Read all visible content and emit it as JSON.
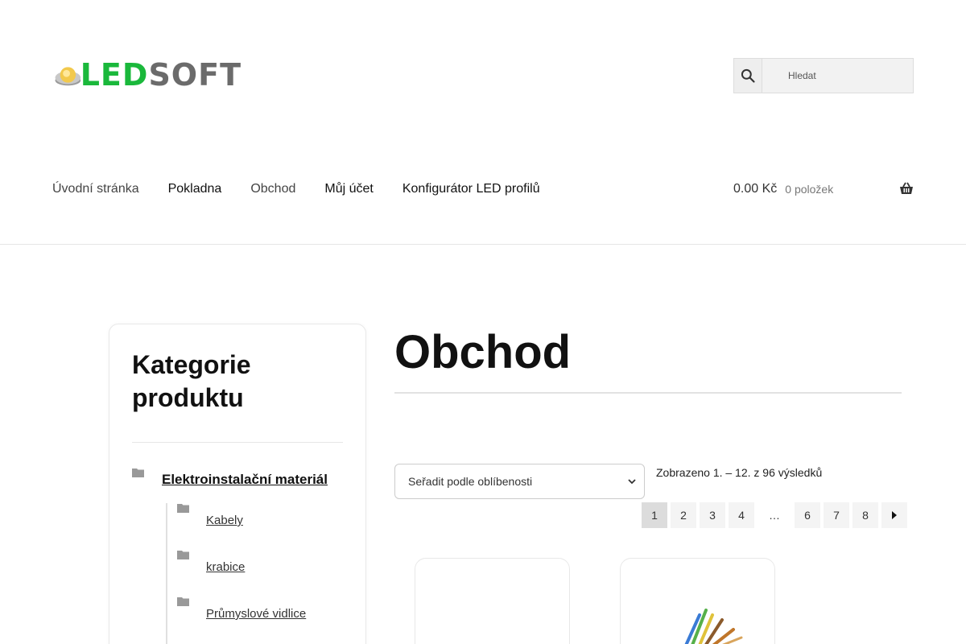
{
  "header": {
    "logo": {
      "part1": "LED",
      "part2": "SOFT"
    },
    "search": {
      "placeholder": "Hledat"
    }
  },
  "nav": {
    "items": [
      {
        "label": "Úvodní stránka"
      },
      {
        "label": "Pokladna"
      },
      {
        "label": "Obchod"
      },
      {
        "label": "Můj účet"
      },
      {
        "label": "Konfigurátor LED profilů"
      }
    ]
  },
  "cart": {
    "amount": "0.00 Kč",
    "count": "0 položek"
  },
  "sidebar": {
    "title": "Kategorie produktu",
    "main_category": "Elektroinstalační materiál",
    "subcategories": [
      {
        "label": "Kabely"
      },
      {
        "label": "krabice"
      },
      {
        "label": "Průmyslové vidlice"
      }
    ]
  },
  "main": {
    "title": "Obchod",
    "sort": {
      "selected": "Seřadit podle oblíbenosti"
    },
    "result_count": "Zobrazeno 1. – 12. z 96 výsledků",
    "pagination": [
      "1",
      "2",
      "3",
      "4",
      "…",
      "6",
      "7",
      "8"
    ]
  },
  "colors": {
    "brand_green": "#1ab83b",
    "brand_gray": "#6b6b6b"
  }
}
